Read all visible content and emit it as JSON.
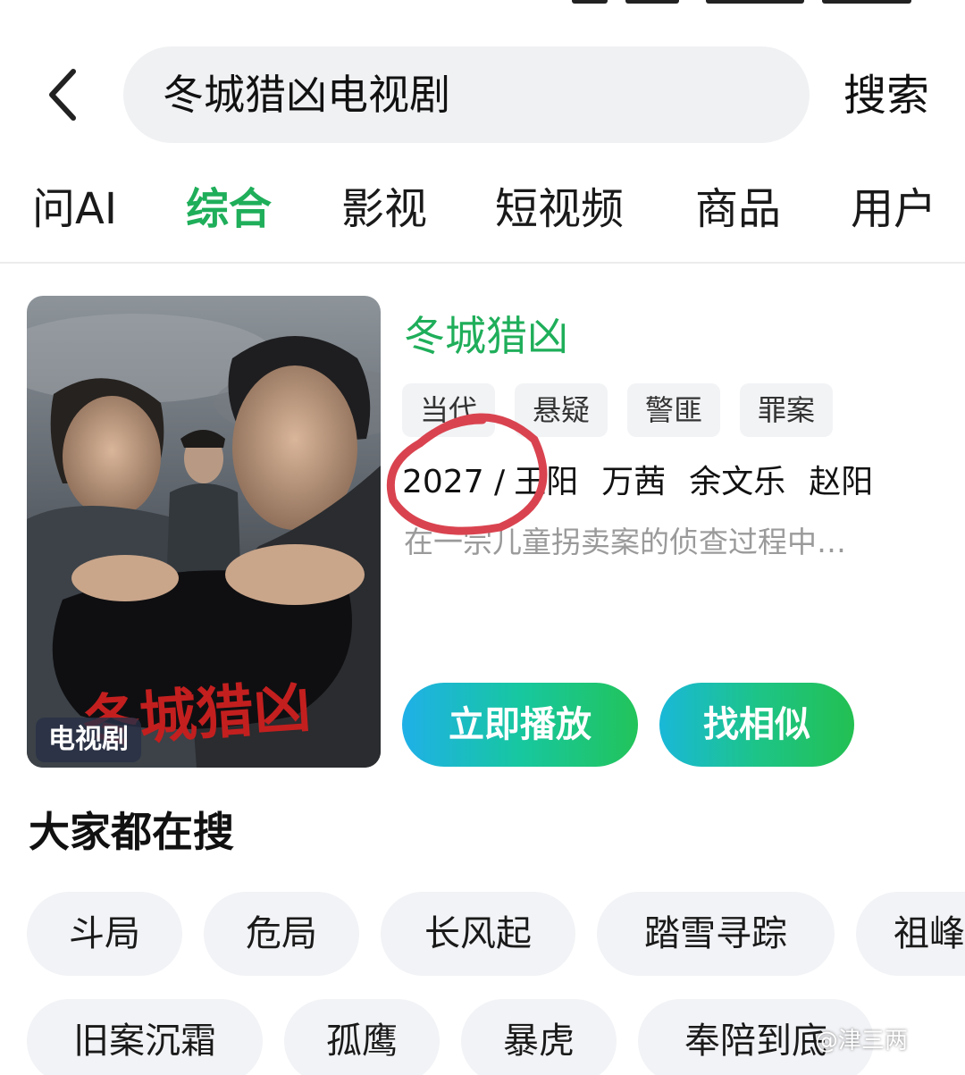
{
  "header": {
    "search_value": "冬城猎凶电视剧",
    "search_button": "搜索"
  },
  "tabs": [
    {
      "label": "问AI"
    },
    {
      "label": "综合",
      "active": true
    },
    {
      "label": "影视"
    },
    {
      "label": "短视频"
    },
    {
      "label": "商品"
    },
    {
      "label": "用户"
    }
  ],
  "result": {
    "poster_badge": "电视剧",
    "poster_title_art": "冬城猎凶",
    "title": "冬城猎凶",
    "tags": [
      "当代",
      "悬疑",
      "警匪",
      "罪案"
    ],
    "year": "2027 /",
    "cast": [
      "王阳",
      "万茜",
      "余文乐",
      "赵阳"
    ],
    "description": "在一宗儿童拐卖案的侦查过程中…",
    "play_button": "立即播放",
    "similar_button": "找相似"
  },
  "hot": {
    "title": "大家都在搜",
    "row1": [
      "斗局",
      "危局",
      "长风起",
      "踏雪寻踪",
      "祖峰"
    ],
    "row2": [
      "旧案沉霜",
      "孤鹰",
      "暴虎",
      "奉陪到底"
    ]
  },
  "watermark": "@津三两",
  "colors": {
    "accent_green": "#1fae5a",
    "annotation_red": "#d9434f"
  }
}
